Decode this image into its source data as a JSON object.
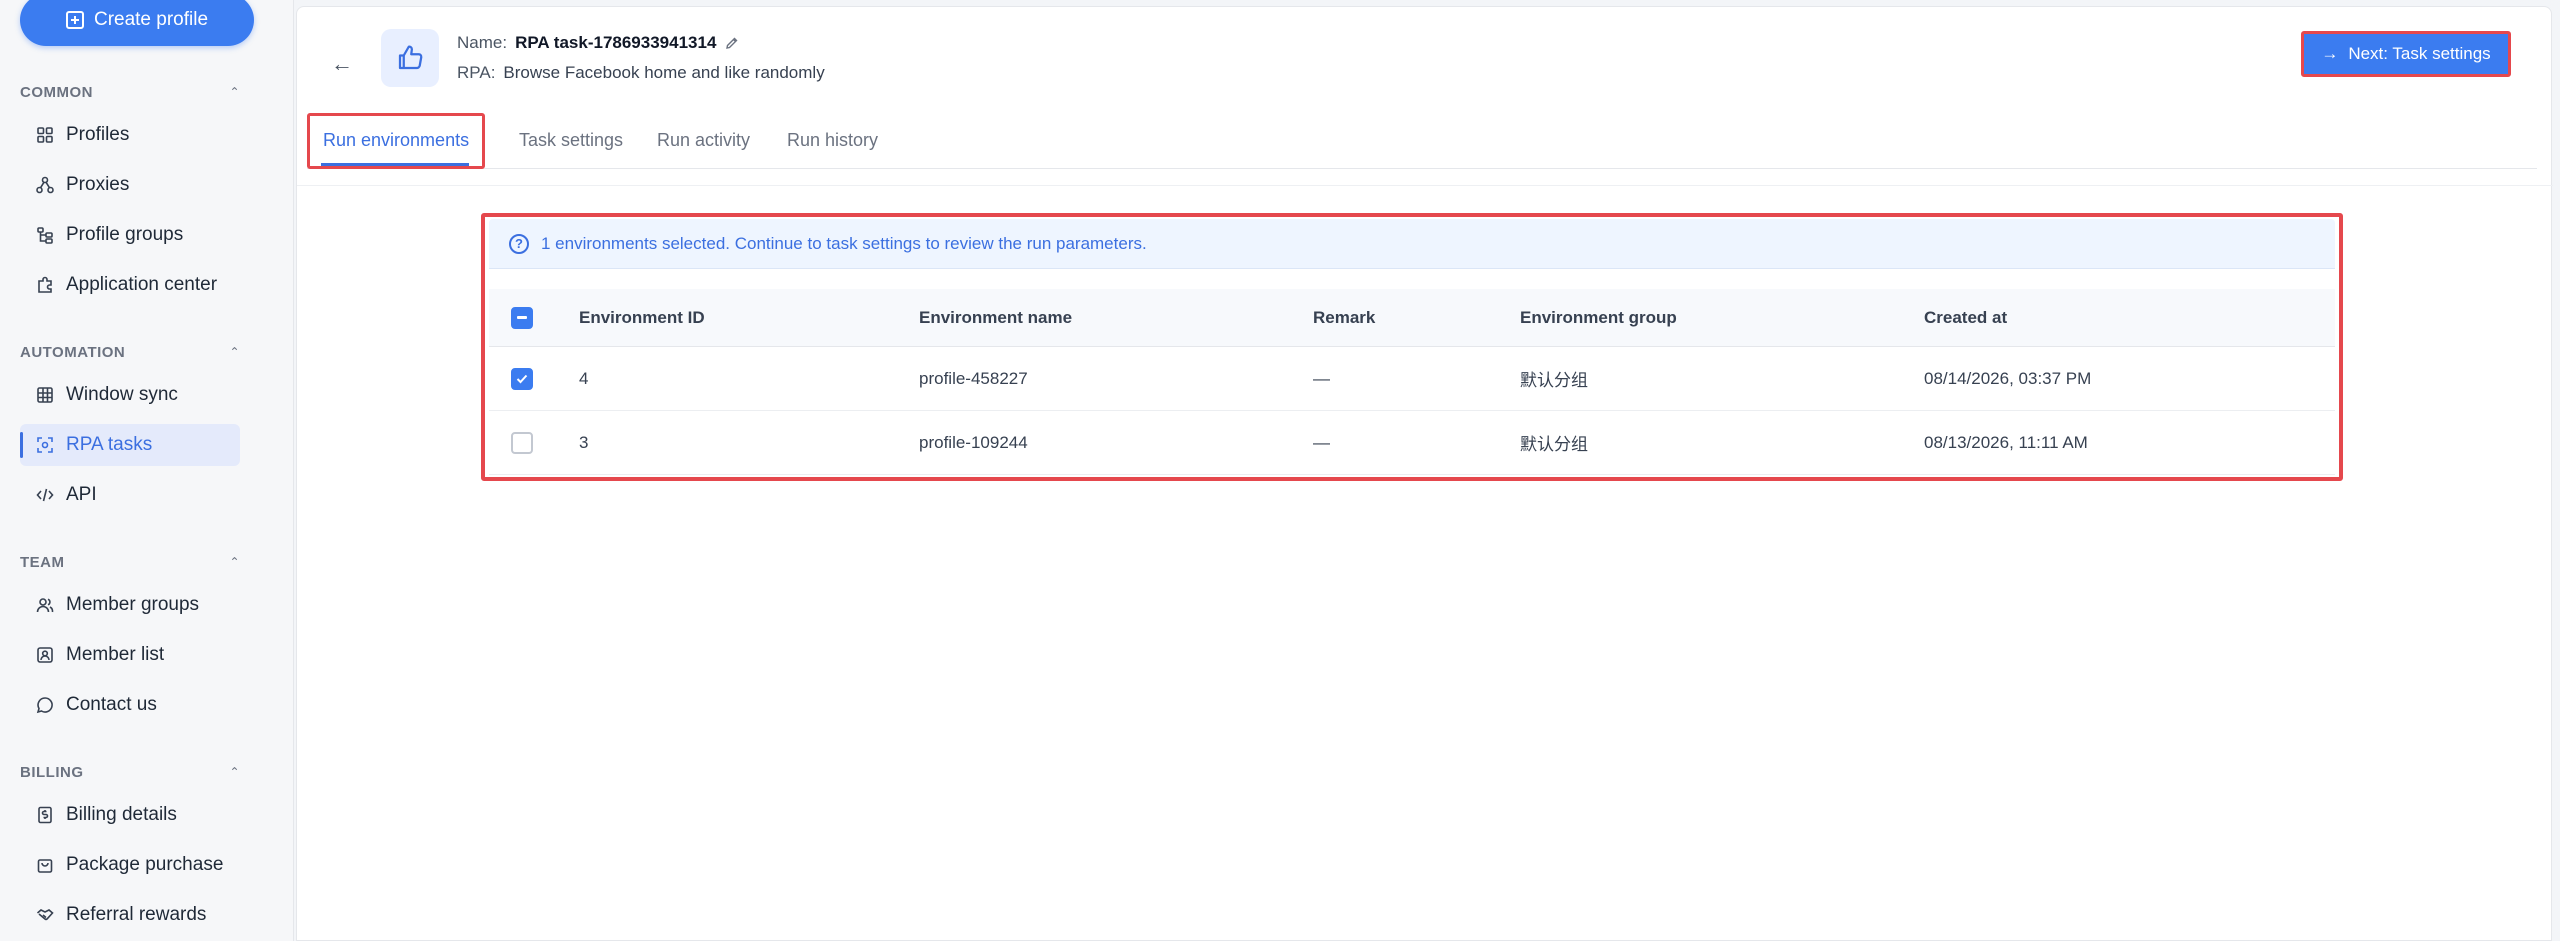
{
  "sidebar": {
    "create_label": "Create profile",
    "sections": {
      "common": "COMMON",
      "automation": "AUTOMATION",
      "team": "TEAM",
      "billing": "BILLING"
    },
    "items": {
      "profiles": "Profiles",
      "proxies": "Proxies",
      "profile_groups": "Profile groups",
      "application_center": "Application center",
      "window_sync": "Window sync",
      "rpa_tasks": "RPA tasks",
      "api": "API",
      "member_groups": "Member groups",
      "member_list": "Member list",
      "contact_us": "Contact us",
      "billing_details": "Billing details",
      "package_purchase": "Package purchase",
      "referral_rewards": "Referral rewards"
    }
  },
  "header": {
    "name_key": "Name:",
    "name_value": "RPA task-1786933941314",
    "rpa_key": "RPA:",
    "rpa_value": "Browse Facebook home and like randomly",
    "next_label": "Next: Task settings"
  },
  "tabs": {
    "run_environments": "Run environments",
    "task_settings": "Task settings",
    "run_activity": "Run activity",
    "run_history": "Run history"
  },
  "info_text": "1 environments selected. Continue to task settings to review the run parameters.",
  "table": {
    "columns": {
      "id": "Environment ID",
      "name": "Environment name",
      "remark": "Remark",
      "group": "Environment group",
      "created": "Created at"
    },
    "rows": [
      {
        "id": "4",
        "name": "profile-458227",
        "remark": "—",
        "group": "默认分组",
        "created": "08/14/2026, 03:37 PM",
        "checked": true
      },
      {
        "id": "3",
        "name": "profile-109244",
        "remark": "—",
        "group": "默认分组",
        "created": "08/13/2026, 11:11 AM",
        "checked": false
      }
    ]
  },
  "colors": {
    "accent": "#3b7cf0",
    "highlight": "#e5484d"
  }
}
